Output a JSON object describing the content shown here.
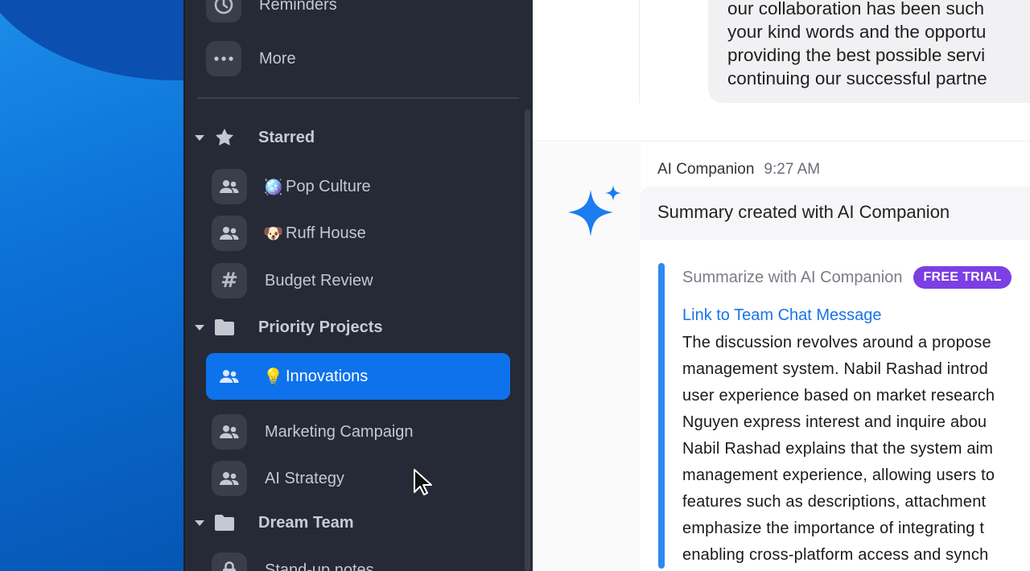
{
  "sidebar": {
    "top_items": [
      {
        "label": "Reminders",
        "icon": "clock-icon"
      },
      {
        "label": "More",
        "icon": "more-icon"
      }
    ],
    "sections": [
      {
        "label": "Starred",
        "icon": "star-icon",
        "channels": [
          {
            "emoji": "🪩",
            "label": "Pop Culture",
            "icon": "group-icon"
          },
          {
            "emoji": "🐶",
            "label": "Ruff House",
            "icon": "group-icon"
          },
          {
            "emoji": "",
            "label": "Budget Review",
            "icon": "hash-icon"
          }
        ]
      },
      {
        "label": "Priority Projects",
        "icon": "folder-icon",
        "channels": [
          {
            "emoji": "💡",
            "label": "Innovations",
            "icon": "group-icon",
            "active": true
          },
          {
            "emoji": "",
            "label": "Marketing Campaign",
            "icon": "group-icon"
          },
          {
            "emoji": "",
            "label": "AI Strategy",
            "icon": "group-icon"
          }
        ]
      },
      {
        "label": "Dream Team",
        "icon": "folder-icon",
        "channels": [
          {
            "emoji": "",
            "label": "Stand-up notes",
            "icon": "lock-icon"
          }
        ]
      }
    ]
  },
  "chat": {
    "previous_message_lines": [
      "our collaboration has been such",
      "your kind words and the opportu",
      "providing the best possible servi",
      "continuing our successful partne"
    ],
    "sender": "AI Companion",
    "time": "9:27 AM",
    "summary_title": "Summary created with AI Companion",
    "summarize_label": "Summarize with AI Companion",
    "badge": "FREE TRIAL",
    "link": "Link to Team Chat Message",
    "body_lines": [
      "The discussion revolves around a propose",
      "management system. Nabil Rashad introd",
      "user experience based on market research",
      "Nguyen express interest and inquire abou",
      "Nabil Rashad explains that the system aim",
      "management experience, allowing users to",
      "features such as descriptions, attachment",
      "emphasize the importance of integrating t",
      "enabling cross-platform access and synch"
    ]
  },
  "colors": {
    "sidebar_bg": "#262a36",
    "active_channel": "#0e72ed",
    "accent_bar": "#2e87f2",
    "badge": "#7b3fe4",
    "link": "#1a73e8"
  }
}
